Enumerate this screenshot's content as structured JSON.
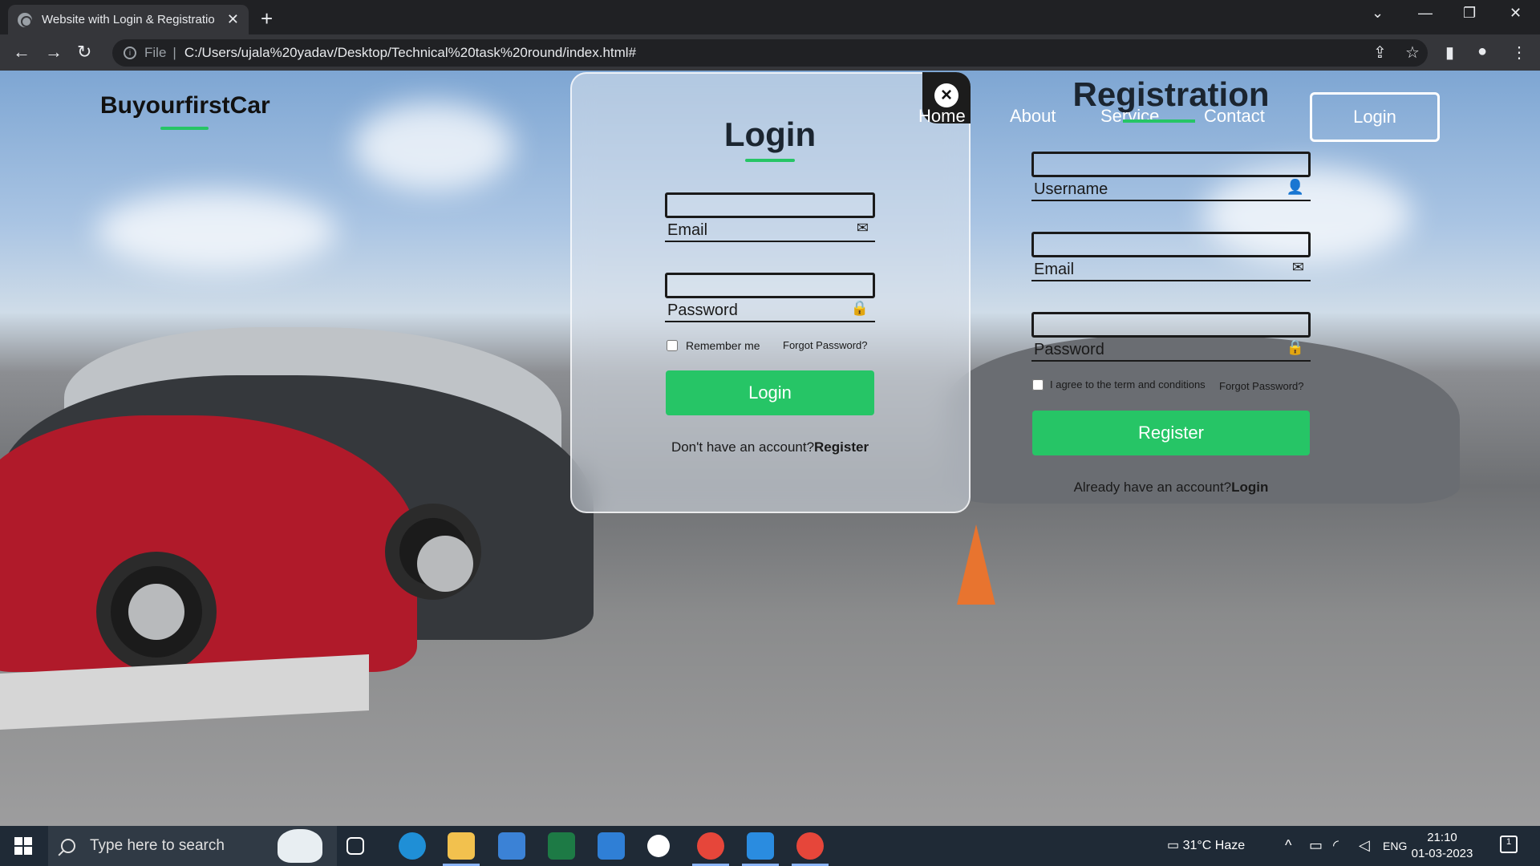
{
  "browser": {
    "tab_title": "Website with Login & Registratio",
    "tab_close": "✕",
    "new_tab": "+",
    "scheme_label": "File",
    "url": "C:/Users/ujala%20yadav/Desktop/Technical%20task%20round/index.html#"
  },
  "site": {
    "brand": "BuyourfirstCar",
    "nav": {
      "home": "Home",
      "about": "About",
      "service": "Service",
      "contact": "Contact",
      "login_button": "Login"
    }
  },
  "login_modal": {
    "close": "×",
    "title": "Login",
    "email_label": "Email",
    "password_label": "Password",
    "remember_me": "Remember me",
    "forgot_password": "Forgot Password?",
    "submit": "Login",
    "footer_text": "Don't have an account?",
    "footer_link": "Register"
  },
  "registration": {
    "title": "Registration",
    "username_label": "Username",
    "email_label": "Email",
    "password_label": "Password",
    "terms": "I agree to the term and conditions",
    "forgot_password": "Forgot Password?",
    "submit": "Register",
    "footer_text": "Already have an account?",
    "footer_link": "Login"
  },
  "taskbar": {
    "search_placeholder": "Type here to search",
    "weather": "31°C  Haze",
    "language": "ENG",
    "time": "21:10",
    "date": "01-03-2023",
    "notification_count": "1"
  },
  "icons": {
    "email": "envelope-icon",
    "password": "lock-icon",
    "username": "user-icon"
  },
  "colors": {
    "accent": "#26c566",
    "chrome_dark": "#202124",
    "taskbar": "#1f2a36"
  }
}
